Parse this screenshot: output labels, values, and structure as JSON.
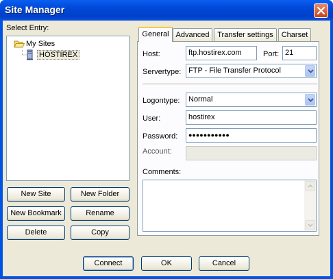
{
  "window": {
    "title": "Site Manager"
  },
  "tree": {
    "label": "Select Entry:",
    "root": "My Sites",
    "children": [
      "HOSTIREX"
    ]
  },
  "buttons": {
    "new_site": "New Site",
    "new_folder": "New Folder",
    "new_bookmark": "New Bookmark",
    "rename": "Rename",
    "delete": "Delete",
    "copy": "Copy"
  },
  "tabs": [
    "General",
    "Advanced",
    "Transfer settings",
    "Charset"
  ],
  "general": {
    "host_label": "Host:",
    "host_value": "ftp.hostirex.com",
    "port_label": "Port:",
    "port_value": "21",
    "servertype_label": "Servertype:",
    "servertype_value": "FTP - File Transfer Protocol",
    "logontype_label": "Logontype:",
    "logontype_value": "Normal",
    "user_label": "User:",
    "user_value": "hostirex",
    "password_label": "Password:",
    "password_value": "●●●●●●●●●●●",
    "account_label": "Account:",
    "account_value": "",
    "comments_label": "Comments:"
  },
  "footer": {
    "connect": "Connect",
    "ok": "OK",
    "cancel": "Cancel"
  },
  "colors": {
    "titlebar": "#0054e3",
    "dialog_bg": "#ece9d8",
    "close_button": "#c8421e",
    "active_tab_accent": "#ffc83c"
  }
}
